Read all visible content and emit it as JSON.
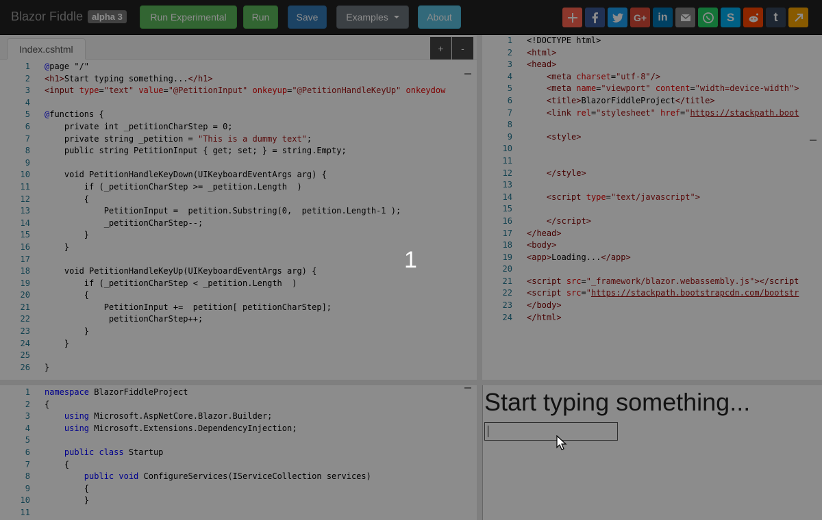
{
  "navbar": {
    "brand": "Blazor Fiddle",
    "badge": "alpha 3",
    "buttons": {
      "run_experimental": "Run Experimental",
      "run": "Run",
      "save": "Save",
      "examples": "Examples",
      "about": "About"
    },
    "share_icons": [
      {
        "name": "addthis-icon",
        "color": "#ff6550"
      },
      {
        "name": "facebook-icon",
        "color": "#3b5998"
      },
      {
        "name": "twitter-icon",
        "color": "#1da1f2"
      },
      {
        "name": "google-plus-icon",
        "color": "#dd4b39"
      },
      {
        "name": "linkedin-icon",
        "color": "#0077b5"
      },
      {
        "name": "email-icon",
        "color": "#848484"
      },
      {
        "name": "whatsapp-icon",
        "color": "#25d366"
      },
      {
        "name": "skype-icon",
        "color": "#00aff0"
      },
      {
        "name": "reddit-icon",
        "color": "#ff4500"
      },
      {
        "name": "tumblr-icon",
        "color": "#35465c"
      },
      {
        "name": "share-arrow-icon",
        "color": "#f7a400"
      }
    ]
  },
  "razor_editor": {
    "tab_label": "Index.cshtml",
    "add_button": "+",
    "remove_button": "-"
  },
  "html_editor": {},
  "csharp_editor": {},
  "output": {
    "heading": "Start typing something...",
    "input_value": ""
  },
  "overlay": {
    "step_label": "1"
  },
  "colors": {
    "navbar_bg": "#222222",
    "success": "#5cb85c",
    "primary": "#337ab7",
    "info": "#5bc0de",
    "line_number": "#237893"
  }
}
